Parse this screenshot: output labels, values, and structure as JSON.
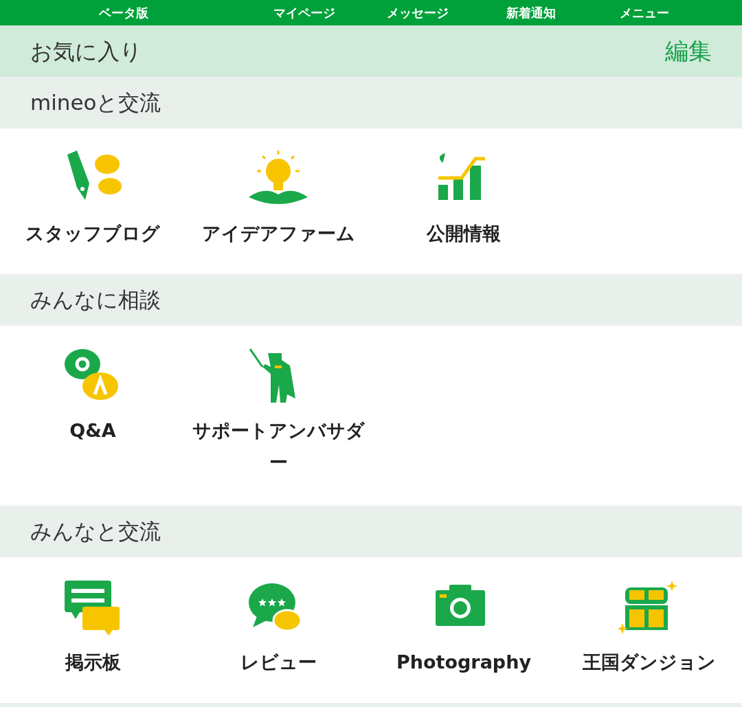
{
  "top_bar": {
    "items": [
      "ベータ版",
      "マイページ",
      "メッセージ",
      "新着通知",
      "メニュー"
    ]
  },
  "favorites": {
    "title": "お気に入り",
    "edit": "編集"
  },
  "sections": [
    {
      "title": "mineoと交流",
      "items": [
        "スタッフブログ",
        "アイデアファーム",
        "公開情報"
      ]
    },
    {
      "title": "みんなに相談",
      "items": [
        "Q&A",
        "サポートアンバサダー"
      ]
    },
    {
      "title": "みんなと交流",
      "items": [
        "掲示板",
        "レビュー",
        "Photography",
        "王国ダンジョン"
      ]
    }
  ]
}
